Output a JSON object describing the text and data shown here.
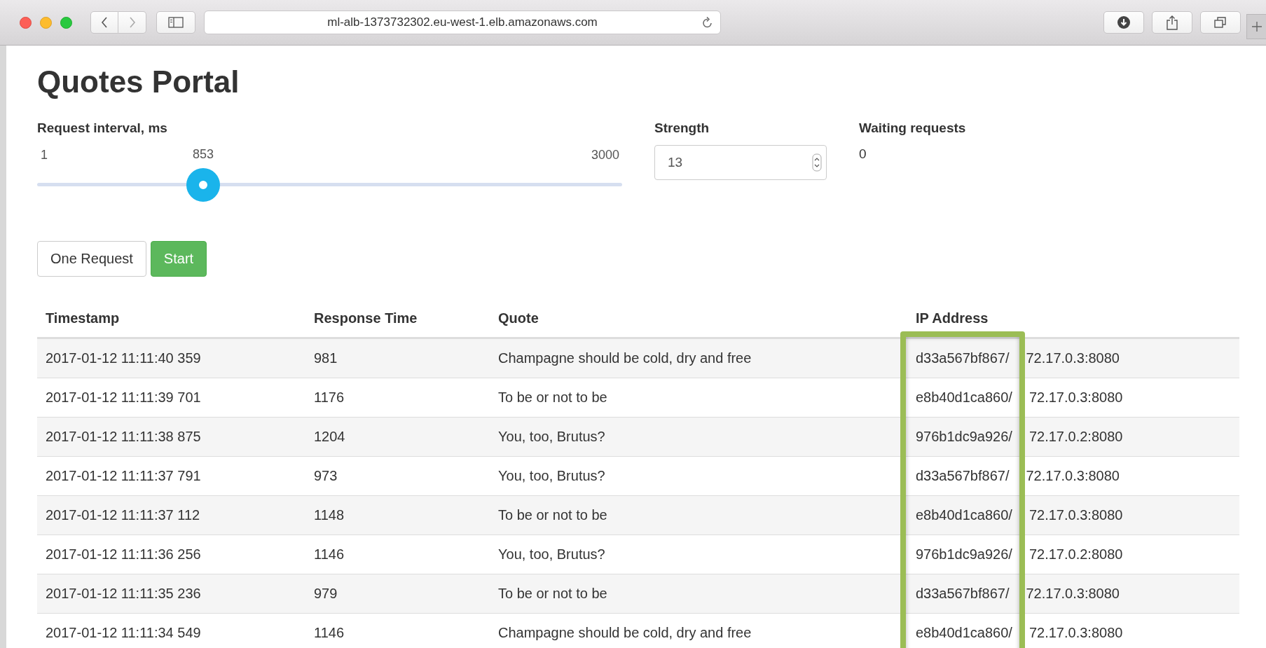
{
  "browser": {
    "url": "ml-alb-1373732302.eu-west-1.elb.amazonaws.com"
  },
  "title": "Quotes Portal",
  "interval": {
    "label": "Request interval, ms",
    "min": "1",
    "value": "853",
    "max": "3000",
    "level": 0.284
  },
  "strength": {
    "label": "Strength",
    "value": "13"
  },
  "waiting": {
    "label": "Waiting requests",
    "value": "0"
  },
  "buttons": [
    {
      "label": "One Request",
      "kind": "default"
    },
    {
      "label": "Start",
      "kind": "success"
    }
  ],
  "table": {
    "columns": [
      "Timestamp",
      "Response Time",
      "Quote",
      "IP Address"
    ],
    "rows": [
      {
        "timestamp": "2017-01-12 11:11:40 359",
        "response_time": "981",
        "quote": "Champagne should be cold, dry and free",
        "ip_host": "d33a567bf867/",
        "ip_rest": "72.17.0.3:8080"
      },
      {
        "timestamp": "2017-01-12 11:11:39 701",
        "response_time": "1176",
        "quote": "To be or not to be",
        "ip_host": "e8b40d1ca860/",
        "ip_rest": "72.17.0.3:8080"
      },
      {
        "timestamp": "2017-01-12 11:11:38 875",
        "response_time": "1204",
        "quote": "You, too, Brutus?",
        "ip_host": "976b1dc9a926/",
        "ip_rest": "72.17.0.2:8080"
      },
      {
        "timestamp": "2017-01-12 11:11:37 791",
        "response_time": "973",
        "quote": "You, too, Brutus?",
        "ip_host": "d33a567bf867/",
        "ip_rest": "72.17.0.3:8080"
      },
      {
        "timestamp": "2017-01-12 11:11:37 112",
        "response_time": "1148",
        "quote": "To be or not to be",
        "ip_host": "e8b40d1ca860/",
        "ip_rest": "72.17.0.3:8080"
      },
      {
        "timestamp": "2017-01-12 11:11:36 256",
        "response_time": "1146",
        "quote": "You, too, Brutus?",
        "ip_host": "976b1dc9a926/",
        "ip_rest": "72.17.0.2:8080"
      },
      {
        "timestamp": "2017-01-12 11:11:35 236",
        "response_time": "979",
        "quote": "To be or not to be",
        "ip_host": "d33a567bf867/",
        "ip_rest": "72.17.0.3:8080"
      },
      {
        "timestamp": "2017-01-12 11:11:34 549",
        "response_time": "1146",
        "quote": "Champagne should be cold, dry and free",
        "ip_host": "e8b40d1ca860/",
        "ip_rest": "72.17.0.3:8080"
      }
    ]
  }
}
